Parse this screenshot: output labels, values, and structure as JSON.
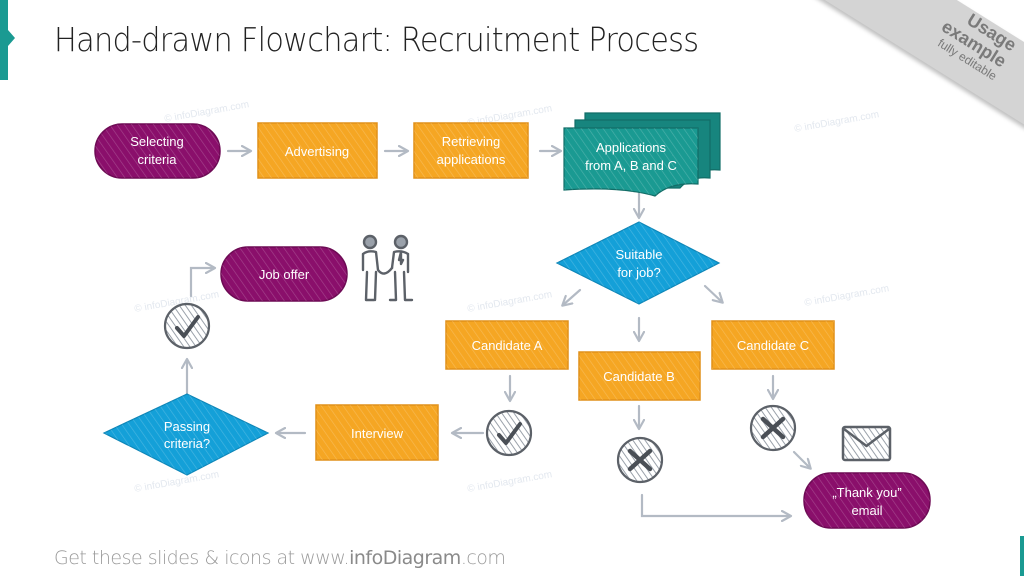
{
  "header": {
    "title": "Hand-drawn Flowchart: Recruitment Process"
  },
  "ribbon": {
    "line1": "Usage",
    "line2": "example",
    "line3": "fully editable"
  },
  "colors": {
    "purple": "#8a0f6b",
    "orange": "#f5a623",
    "teal": "#1a9a92",
    "blue": "#14a0d8",
    "arrow": "#b3bac4",
    "icon": "#5c6168",
    "accent": "#1a9a92"
  },
  "watermark": "© infoDiagram.com",
  "nodes": {
    "selecting_criteria": [
      "Selecting",
      "criteria"
    ],
    "advertising": "Advertising",
    "retrieving_applications": [
      "Retrieving",
      "applications"
    ],
    "applications": [
      "Applications",
      "from A, B and C"
    ],
    "suitable": [
      "Suitable",
      "for job?"
    ],
    "candidate_a": "Candidate A",
    "candidate_b": "Candidate B",
    "candidate_c": "Candidate C",
    "interview": "Interview",
    "passing": [
      "Passing",
      "criteria?"
    ],
    "job_offer": "Job offer",
    "thank_you": [
      "„Thank you”",
      "email"
    ]
  },
  "icons": {
    "check_a": "check-circle",
    "check_passing": "check-circle",
    "x_b": "x-circle",
    "x_c": "x-circle",
    "envelope": "envelope",
    "handshake": "handshake-people"
  },
  "footer": {
    "prefix": "Get these slides & icons at www.",
    "brand": "infoDiagram",
    "suffix": ".com"
  }
}
